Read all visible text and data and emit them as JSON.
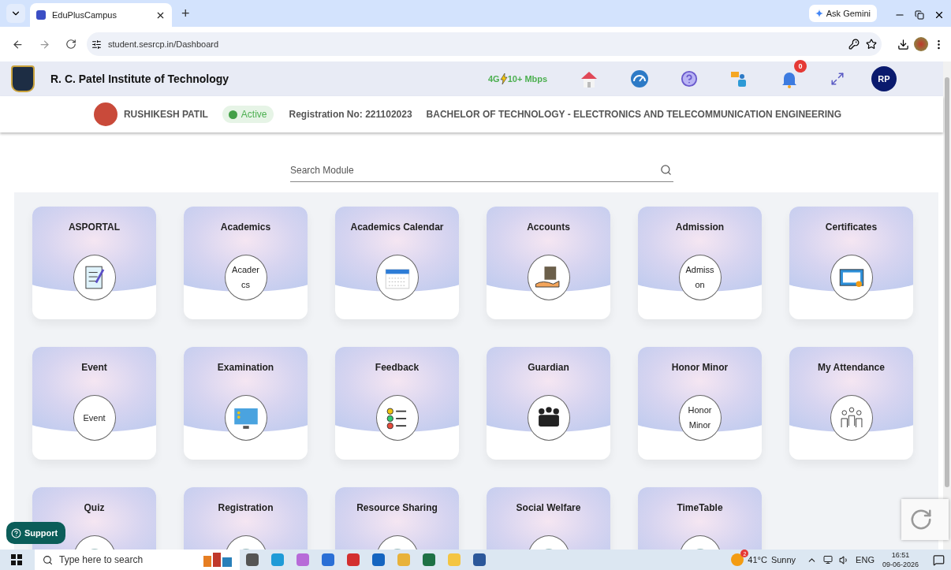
{
  "browser": {
    "tabs": [
      {
        "title": "EduPlusCampus",
        "selected": true
      }
    ],
    "new_tab": "+",
    "ask_gemini": "Ask Gemini",
    "url": "student.sesrcp.in/Dashboard"
  },
  "header": {
    "institute": "R. C. Patel Institute of Technology",
    "network": "4G",
    "speed": "10+ Mbps",
    "notification_count": "0",
    "avatar": "RP"
  },
  "profile": {
    "name": "RUSHIKESH PATIL",
    "status": "Active",
    "registration": "Registration No: 221102023",
    "program": "BACHELOR OF TECHNOLOGY - ELECTRONICS AND TELECOMMUNICATION ENGINEERING"
  },
  "search": {
    "placeholder": "Search Module"
  },
  "modules": [
    {
      "title": "ASPORTAL",
      "kind": "image"
    },
    {
      "title": "Academics",
      "kind": "broken",
      "alt_lines": [
        "Acader",
        "cs"
      ]
    },
    {
      "title": "Academics Calendar",
      "kind": "image"
    },
    {
      "title": "Accounts",
      "kind": "image"
    },
    {
      "title": "Admission",
      "kind": "broken",
      "alt_lines": [
        "Admiss",
        "on"
      ]
    },
    {
      "title": "Certificates",
      "kind": "image"
    },
    {
      "title": "Event",
      "kind": "broken",
      "alt_lines": [
        "Event"
      ]
    },
    {
      "title": "Examination",
      "kind": "image"
    },
    {
      "title": "Feedback",
      "kind": "image"
    },
    {
      "title": "Guardian",
      "kind": "image"
    },
    {
      "title": "Honor Minor",
      "kind": "broken",
      "alt_lines": [
        "Honor",
        "Minor"
      ]
    },
    {
      "title": "My Attendance",
      "kind": "image"
    },
    {
      "title": "Quiz",
      "kind": "image"
    },
    {
      "title": "Registration",
      "kind": "image"
    },
    {
      "title": "Resource Sharing",
      "kind": "image"
    },
    {
      "title": "Social Welfare",
      "kind": "image"
    },
    {
      "title": "TimeTable",
      "kind": "image"
    }
  ],
  "support": "Support",
  "taskbar": {
    "search_placeholder": "Type here to search",
    "weather_badge": "2",
    "temperature": "41°C",
    "condition": "Sunny",
    "language": "ENG",
    "time": "16:51",
    "date": "09-06-2026"
  }
}
